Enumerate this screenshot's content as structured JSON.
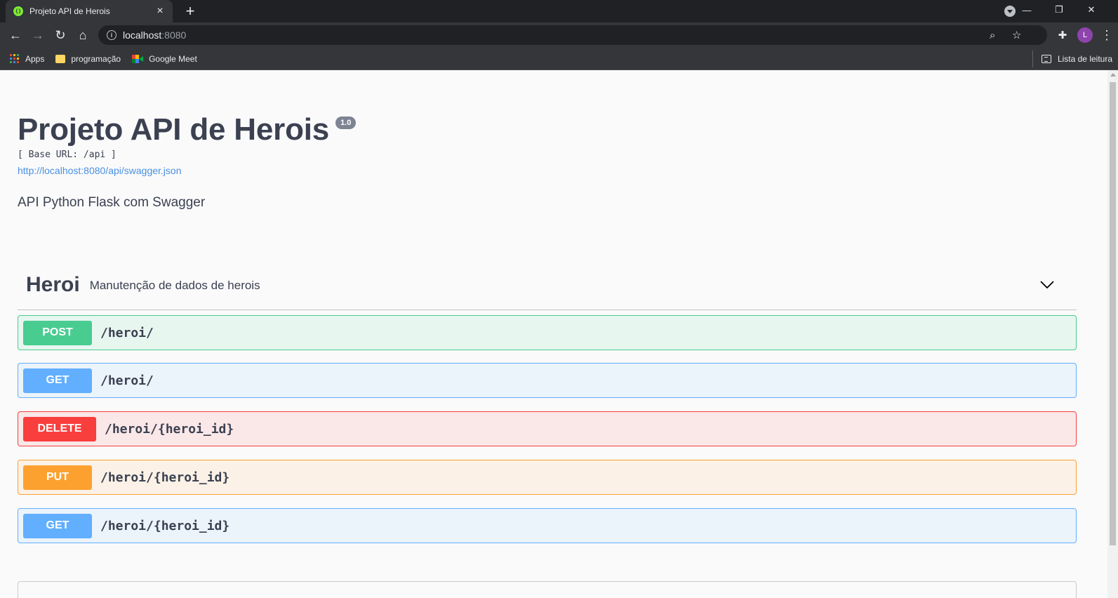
{
  "browser": {
    "tab_title": "Projeto API de Herois",
    "url_host": "localhost",
    "url_port": ":8080",
    "bookmarks": [
      {
        "label": "Apps",
        "icon": "apps-grid-icon"
      },
      {
        "label": "programação",
        "icon": "folder-icon"
      },
      {
        "label": "Google Meet",
        "icon": "google-meet-icon"
      }
    ],
    "reading_list_label": "Lista de leitura",
    "profile_initial": "L",
    "profile_color": "#8e44ad"
  },
  "api": {
    "title": "Projeto API de Herois",
    "version": "1.0",
    "base_url": "[ Base URL: /api ]",
    "spec_url": "http://localhost:8080/api/swagger.json",
    "description": "API Python Flask com Swagger"
  },
  "tag": {
    "name": "Heroi",
    "description": "Manutenção de dados de herois",
    "expanded": true
  },
  "operations": [
    {
      "method": "POST",
      "path": "/heroi/",
      "color": "#49cc90"
    },
    {
      "method": "GET",
      "path": "/heroi/",
      "color": "#61affe"
    },
    {
      "method": "DELETE",
      "path": "/heroi/{heroi_id}",
      "color": "#f93e3e"
    },
    {
      "method": "PUT",
      "path": "/heroi/{heroi_id}",
      "color": "#fca130"
    },
    {
      "method": "GET",
      "path": "/heroi/{heroi_id}",
      "color": "#61affe"
    }
  ]
}
